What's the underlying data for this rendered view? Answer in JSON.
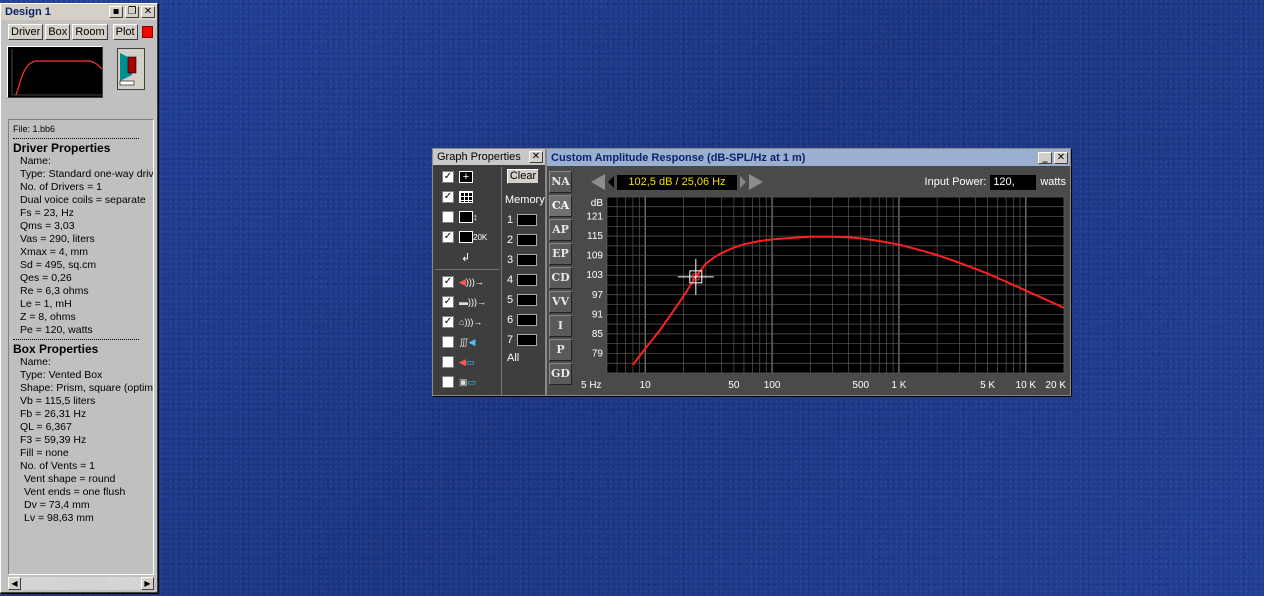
{
  "design_window": {
    "title": "Design 1",
    "title_buttons": [
      "save-icon",
      "restore-icon",
      "close-icon"
    ],
    "tabs": [
      "Driver",
      "Box",
      "Room",
      "Plot"
    ],
    "plot_color": "#ff0000"
  },
  "properties": {
    "file": "File: 1.bb6",
    "driver_heading": "Driver Properties",
    "driver_rows": [
      "Name:",
      "Type: Standard one-way driv",
      "No. of Drivers = 1",
      "Dual voice coils = separate",
      "Fs =  23, Hz",
      "Qms =  3,03",
      "Vas =  290, liters",
      "Xmax =  4, mm",
      "Sd =  495, sq.cm",
      "Qes =  0,26",
      "Re =  6,3 ohms",
      "Le =  1, mH",
      "Z =  8, ohms",
      "Pe =  120, watts"
    ],
    "box_heading": "Box Properties",
    "box_rows": [
      "Name:",
      "Type: Vented Box",
      "Shape: Prism, square (optimu",
      "Vb =  115,5 liters",
      "Fb =  26,31 Hz",
      "QL =  6,367",
      "F3 =  59,39 Hz",
      "Fill = none",
      "No. of Vents = 1"
    ],
    "vent_rows": [
      "Vent shape = round",
      "Vent ends = one flush",
      "Dv =  73,4 mm",
      "Lv =  98,63 mm"
    ]
  },
  "graph_properties": {
    "title": "Graph Properties",
    "options": [
      {
        "icon": "crosshair-icon",
        "checked": true
      },
      {
        "icon": "grid-icon",
        "checked": true
      },
      {
        "icon": "vertical-resize-icon",
        "checked": false
      },
      {
        "icon": "range-20k-icon",
        "checked": true,
        "label": "20K"
      },
      {
        "icon": "return-arrow-icon",
        "checked": null
      },
      {
        "icon": "driver-signal-icon",
        "checked": true
      },
      {
        "icon": "box-signal-icon",
        "checked": true
      },
      {
        "icon": "room-signal-icon",
        "checked": true
      },
      {
        "icon": "coil-speaker-icon",
        "checked": false
      },
      {
        "icon": "speaker-graph-icon",
        "checked": false
      },
      {
        "icon": "box-graph-icon",
        "checked": false
      }
    ],
    "clear_label": "Clear",
    "memory_label": "Memory",
    "memory_slots": [
      "1",
      "2",
      "3",
      "4",
      "5",
      "6",
      "7"
    ],
    "all_label": "All"
  },
  "response_window": {
    "title": "Custom Amplitude Response (dB-SPL/Hz at 1 m)",
    "side_tabs": [
      "NA",
      "CA",
      "AP",
      "EP",
      "CD",
      "VV",
      "I",
      "P",
      "GD"
    ],
    "selected_tab": "CA",
    "readout": "102,5 dB / 25,06 Hz",
    "input_power_label": "Input Power:",
    "input_power_value": "120,",
    "input_power_unit": "watts"
  },
  "chart_data": {
    "type": "line",
    "title": "Custom Amplitude Response (dB-SPL/Hz at 1 m)",
    "xlabel": "",
    "ylabel": "dB",
    "x_scale": "log",
    "xlim": [
      5,
      20000
    ],
    "ylim": [
      73,
      127
    ],
    "x_ticks": [
      "5 Hz",
      "10",
      "50",
      "100",
      "500",
      "1 K",
      "5 K",
      "10 K",
      "20 K"
    ],
    "x_tick_values": [
      5,
      10,
      50,
      100,
      500,
      1000,
      5000,
      10000,
      20000
    ],
    "y_ticks": [
      "121",
      "115",
      "109",
      "103",
      "97",
      "91",
      "85",
      "79"
    ],
    "y_tick_values": [
      121,
      115,
      109,
      103,
      97,
      91,
      85,
      79
    ],
    "grid": true,
    "background": "#000000",
    "line_color": "#ff2020",
    "series": [
      {
        "x": [
          8,
          10,
          13,
          16,
          20,
          25,
          30,
          35,
          40,
          50,
          60,
          80,
          100,
          150,
          200,
          300,
          400,
          500,
          700,
          1000,
          1500,
          2000,
          3000,
          5000,
          7000,
          10000,
          15000,
          20000
        ],
        "y": [
          75.5,
          80.5,
          86.0,
          91.0,
          96.5,
          102.5,
          106.5,
          108.5,
          109.8,
          111.5,
          112.5,
          113.5,
          114.0,
          114.5,
          114.8,
          114.8,
          114.6,
          114.3,
          113.5,
          112.4,
          110.6,
          109.2,
          106.8,
          103.5,
          101.0,
          98.3,
          95.2,
          93.0
        ]
      }
    ],
    "cursor": {
      "x": 25.06,
      "y": 102.5
    }
  }
}
